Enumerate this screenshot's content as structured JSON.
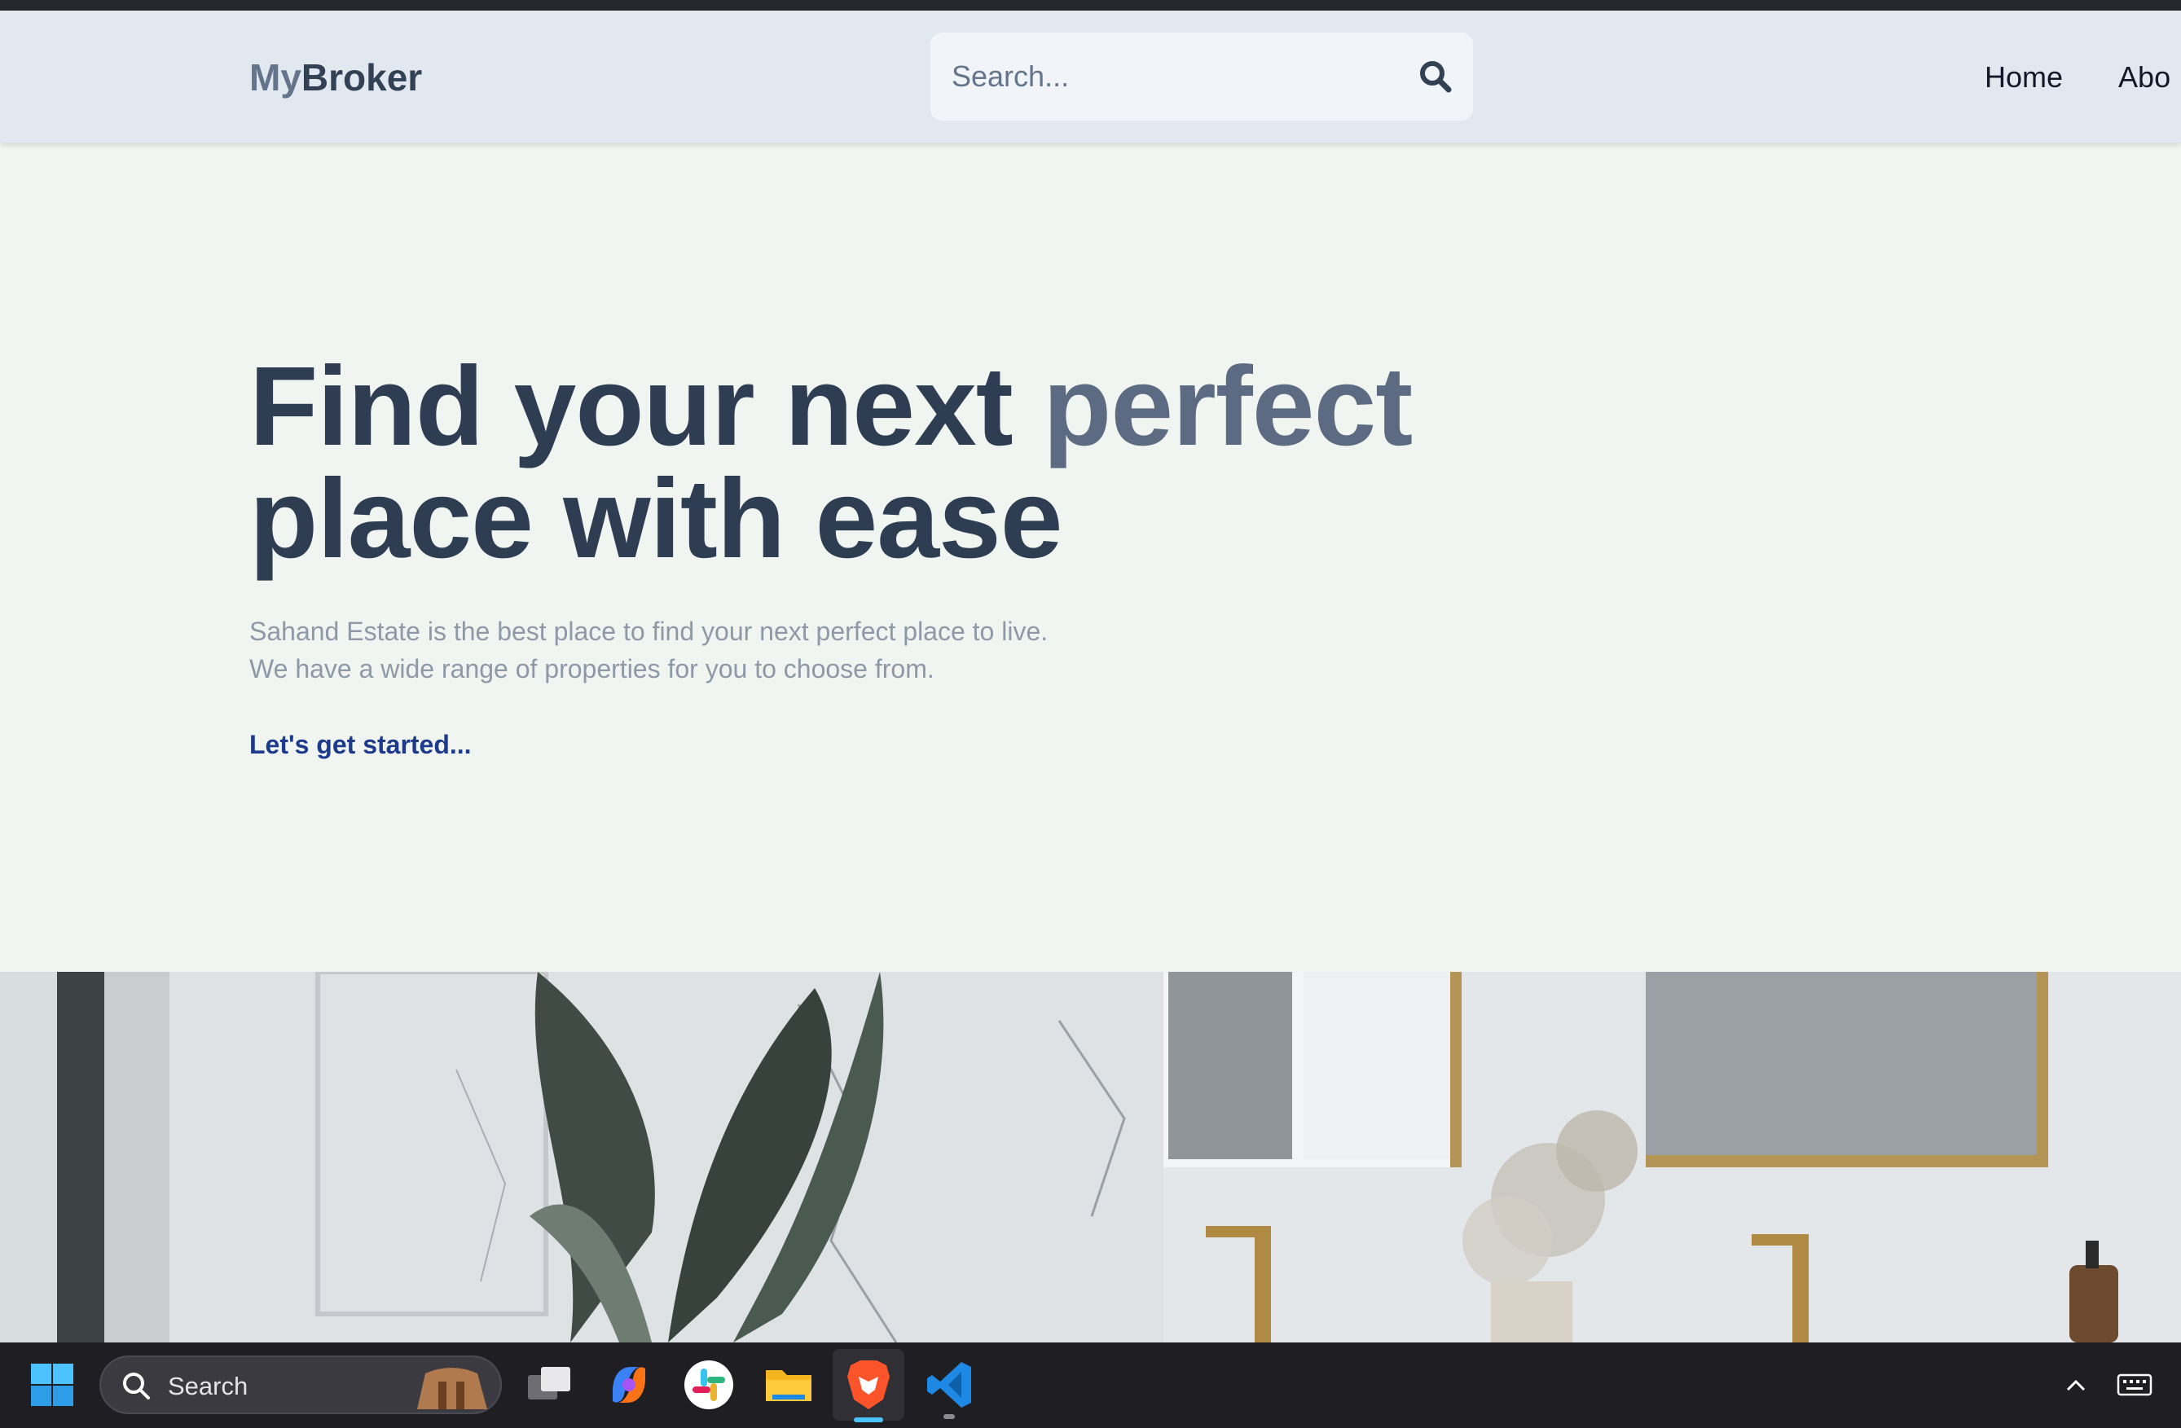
{
  "header": {
    "logo_prefix": "My",
    "logo_suffix": "Broker",
    "search_placeholder": "Search...",
    "nav": [
      "Home",
      "Abo"
    ]
  },
  "hero": {
    "title_part1": "Find your next ",
    "title_accent": "perfect",
    "title_line2": "place with ease",
    "desc_line1": "Sahand Estate is the best place to find your next perfect place to live.",
    "desc_line2": "We have a wide range of properties for you to choose from.",
    "cta": "Let's get started..."
  },
  "taskbar": {
    "search_label": "Search",
    "apps": [
      "task-view",
      "copilot",
      "slack",
      "file-explorer",
      "brave-browser",
      "vscode"
    ]
  },
  "colors": {
    "accent_text": "#5c6b81",
    "title_text": "#2e3d52",
    "cta": "#1e3a8a",
    "header_bg": "#e2e8f0",
    "page_bg": "#f1f5f1"
  }
}
